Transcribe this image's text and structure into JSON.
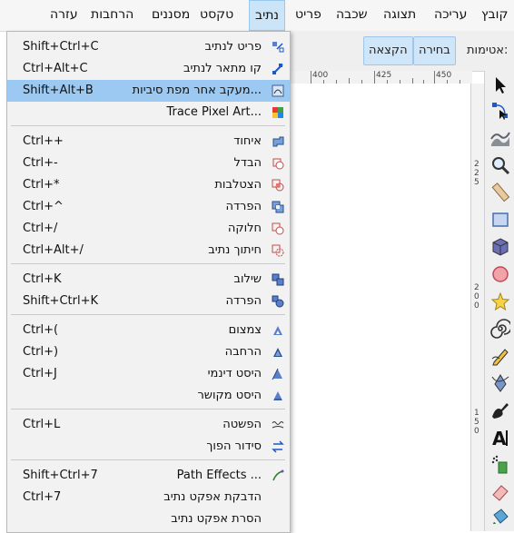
{
  "menubar": {
    "items": [
      "קובץ",
      "עריכה",
      "תצוגה",
      "שכבה",
      "פריט",
      "נתיב",
      "טקסט",
      "מסננים",
      "הרחבות",
      "עזרה"
    ]
  },
  "toolbar": {
    "snap_label": "אטימות:",
    "selection_btn": "בחירה",
    "group_btn": "הקצאה"
  },
  "ruler": {
    "labels": [
      "400",
      "425",
      "450"
    ],
    "vlabels": [
      "225",
      "200",
      "150"
    ]
  },
  "menu": {
    "items": [
      {
        "label": "פריט לנתיב",
        "shortcut": "Shift+Ctrl+C",
        "icon": "object-to-path-icon",
        "highlight": false
      },
      {
        "label": "קו מתאר לנתיב",
        "shortcut": "Ctrl+Alt+C",
        "icon": "stroke-to-path-icon",
        "highlight": false
      },
      {
        "label": "מעקב אחר מפת סיביות...",
        "shortcut": "Shift+Alt+B",
        "icon": "trace-bitmap-icon",
        "highlight": true
      },
      {
        "label": "Trace Pixel Art...",
        "shortcut": "",
        "icon": "trace-pixel-art-icon",
        "highlight": false
      },
      {
        "label": "איחוד",
        "shortcut": "Ctrl++",
        "icon": "path-union-icon",
        "highlight": false
      },
      {
        "label": "הבדל",
        "shortcut": "Ctrl+-",
        "icon": "path-difference-icon",
        "highlight": false
      },
      {
        "label": "הצטלבות",
        "shortcut": "Ctrl+*",
        "icon": "path-intersection-icon",
        "highlight": false
      },
      {
        "label": "הפרדה",
        "shortcut": "Ctrl+^",
        "icon": "path-exclusion-icon",
        "highlight": false
      },
      {
        "label": "חלוקה",
        "shortcut": "Ctrl+/",
        "icon": "path-division-icon",
        "highlight": false
      },
      {
        "label": "חיתוך נתיב",
        "shortcut": "Ctrl+Alt+/",
        "icon": "path-cut-icon",
        "highlight": false
      },
      {
        "label": "שילוב",
        "shortcut": "Ctrl+K",
        "icon": "path-combine-icon",
        "highlight": false
      },
      {
        "label": "הפרדה",
        "shortcut": "Shift+Ctrl+K",
        "icon": "path-break-apart-icon",
        "highlight": false
      },
      {
        "label": "צמצום",
        "shortcut": "Ctrl+(",
        "icon": "path-inset-icon",
        "highlight": false
      },
      {
        "label": "הרחבה",
        "shortcut": "Ctrl+)",
        "icon": "path-outset-icon",
        "highlight": false
      },
      {
        "label": "היסט דינמי",
        "shortcut": "Ctrl+J",
        "icon": "dynamic-offset-icon",
        "highlight": false
      },
      {
        "label": "היסט מקושר",
        "shortcut": "",
        "icon": "linked-offset-icon",
        "highlight": false
      },
      {
        "label": "הפשטה",
        "shortcut": "Ctrl+L",
        "icon": "path-simplify-icon",
        "highlight": false
      },
      {
        "label": "סידור הפוך",
        "shortcut": "",
        "icon": "path-reverse-icon",
        "highlight": false
      },
      {
        "label": "Path Effects ...",
        "shortcut": "Shift+Ctrl+7",
        "icon": "path-effects-icon",
        "highlight": false
      },
      {
        "label": "הדבקת אפקט נתיב",
        "shortcut": "Ctrl+7",
        "icon": "",
        "highlight": false
      },
      {
        "label": "הסרת אפקט נתיב",
        "shortcut": "",
        "icon": "",
        "highlight": false
      }
    ]
  },
  "tools": [
    "selector-tool-icon",
    "node-tool-icon",
    "tweak-tool-icon",
    "zoom-tool-icon",
    "measure-tool-icon",
    "rect-tool-icon",
    "3dbox-tool-icon",
    "ellipse-tool-icon",
    "star-tool-icon",
    "spiral-tool-icon",
    "pencil-tool-icon",
    "pen-tool-icon",
    "calligraphy-tool-icon",
    "text-tool-icon",
    "spray-tool-icon",
    "eraser-tool-icon",
    "bucket-tool-icon"
  ],
  "colors": {
    "highlight": "#9bc9f1",
    "accent": "#2a6fcf"
  }
}
